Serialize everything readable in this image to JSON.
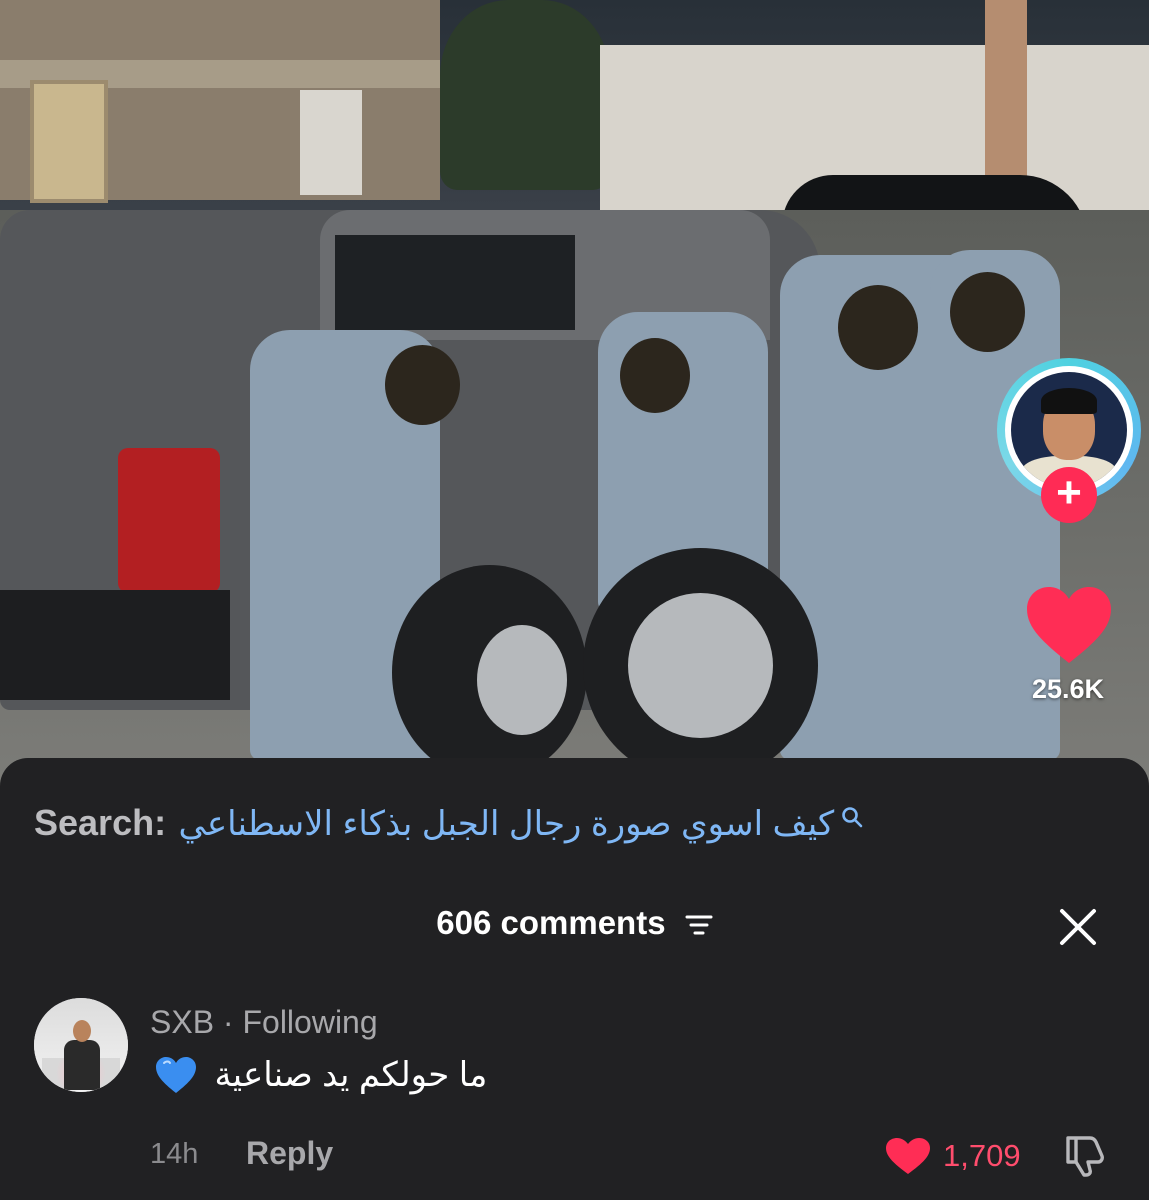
{
  "video": {
    "like_count": "25.6K",
    "follow_icon": "plus-icon",
    "like_icon": "heart-icon"
  },
  "search": {
    "label": "Search:",
    "query": "كيف اسوي صورة رجال الجبل بذكاء الاسطناعي",
    "icon": "search-icon",
    "color": "#7fb7f5"
  },
  "comments_header": {
    "title": "606 comments",
    "filter_icon": "filter-icon",
    "close_icon": "close-icon"
  },
  "comment": {
    "author": "SXB",
    "separator": " · ",
    "relation": "Following",
    "emoji": "blue-heart",
    "text": "ما حولكم يد صناعية",
    "time": "14h",
    "reply_label": "Reply",
    "likes": "1,709",
    "like_color": "#ff4d6d",
    "dislike_icon": "thumbs-down-icon"
  }
}
